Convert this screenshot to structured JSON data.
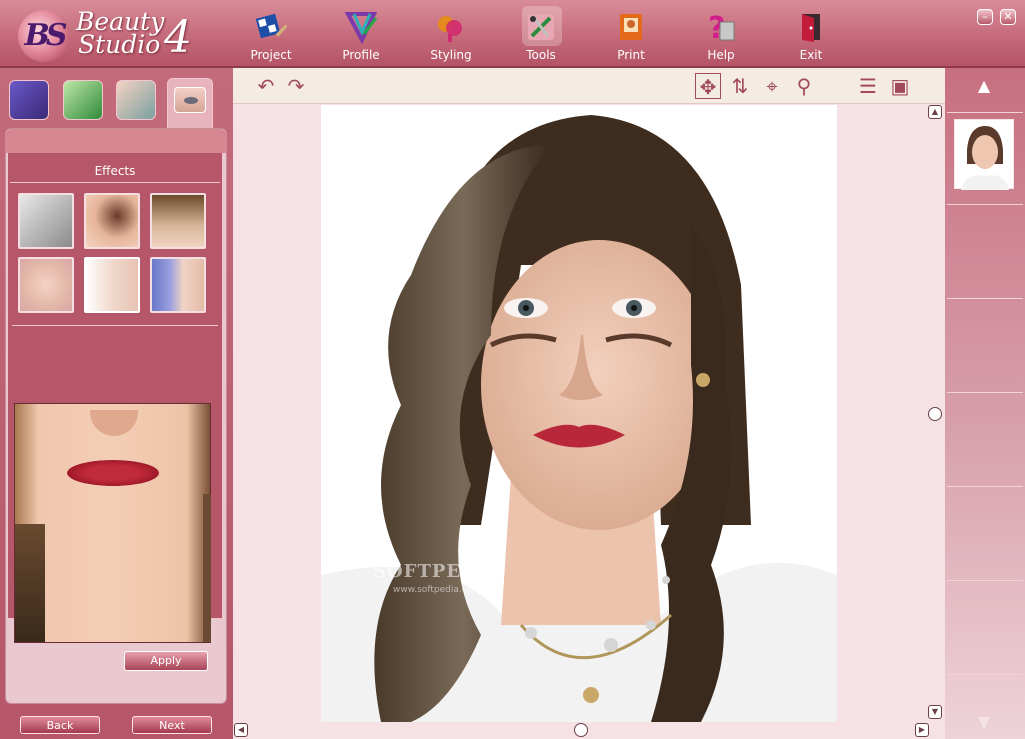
{
  "app": {
    "logo_line1": "Beauty",
    "logo_line2": "Studio",
    "logo_version": "4",
    "logo_mark": "BS"
  },
  "nav": [
    {
      "label": "Project",
      "icon": "project-icon",
      "active": false
    },
    {
      "label": "Profile",
      "icon": "profile-icon",
      "active": false
    },
    {
      "label": "Styling",
      "icon": "styling-icon",
      "active": false
    },
    {
      "label": "Tools",
      "icon": "tools-icon",
      "active": true
    },
    {
      "label": "Print",
      "icon": "print-icon",
      "active": false
    },
    {
      "label": "Help",
      "icon": "help-icon",
      "active": false
    },
    {
      "label": "Exit",
      "icon": "exit-icon",
      "active": false
    }
  ],
  "window_controls": {
    "minimize": "–",
    "close": "✕"
  },
  "left_panel": {
    "effects_title": "Effects",
    "apply_label": "Apply",
    "back_label": "Back",
    "next_label": "Next"
  },
  "toolbar": {
    "undo": "↶",
    "redo": "↷",
    "move": "✥",
    "flip": "⇅",
    "target": "⌖",
    "zoom": "⚲",
    "menu": "☰",
    "camera": "▣"
  },
  "watermark": {
    "main": "SOFTPEDIA",
    "sub": "www.softpedia.com"
  },
  "colors": {
    "brand": "#c66b7b",
    "dark": "#a84459",
    "canvas_bg": "#f6e2e5"
  }
}
